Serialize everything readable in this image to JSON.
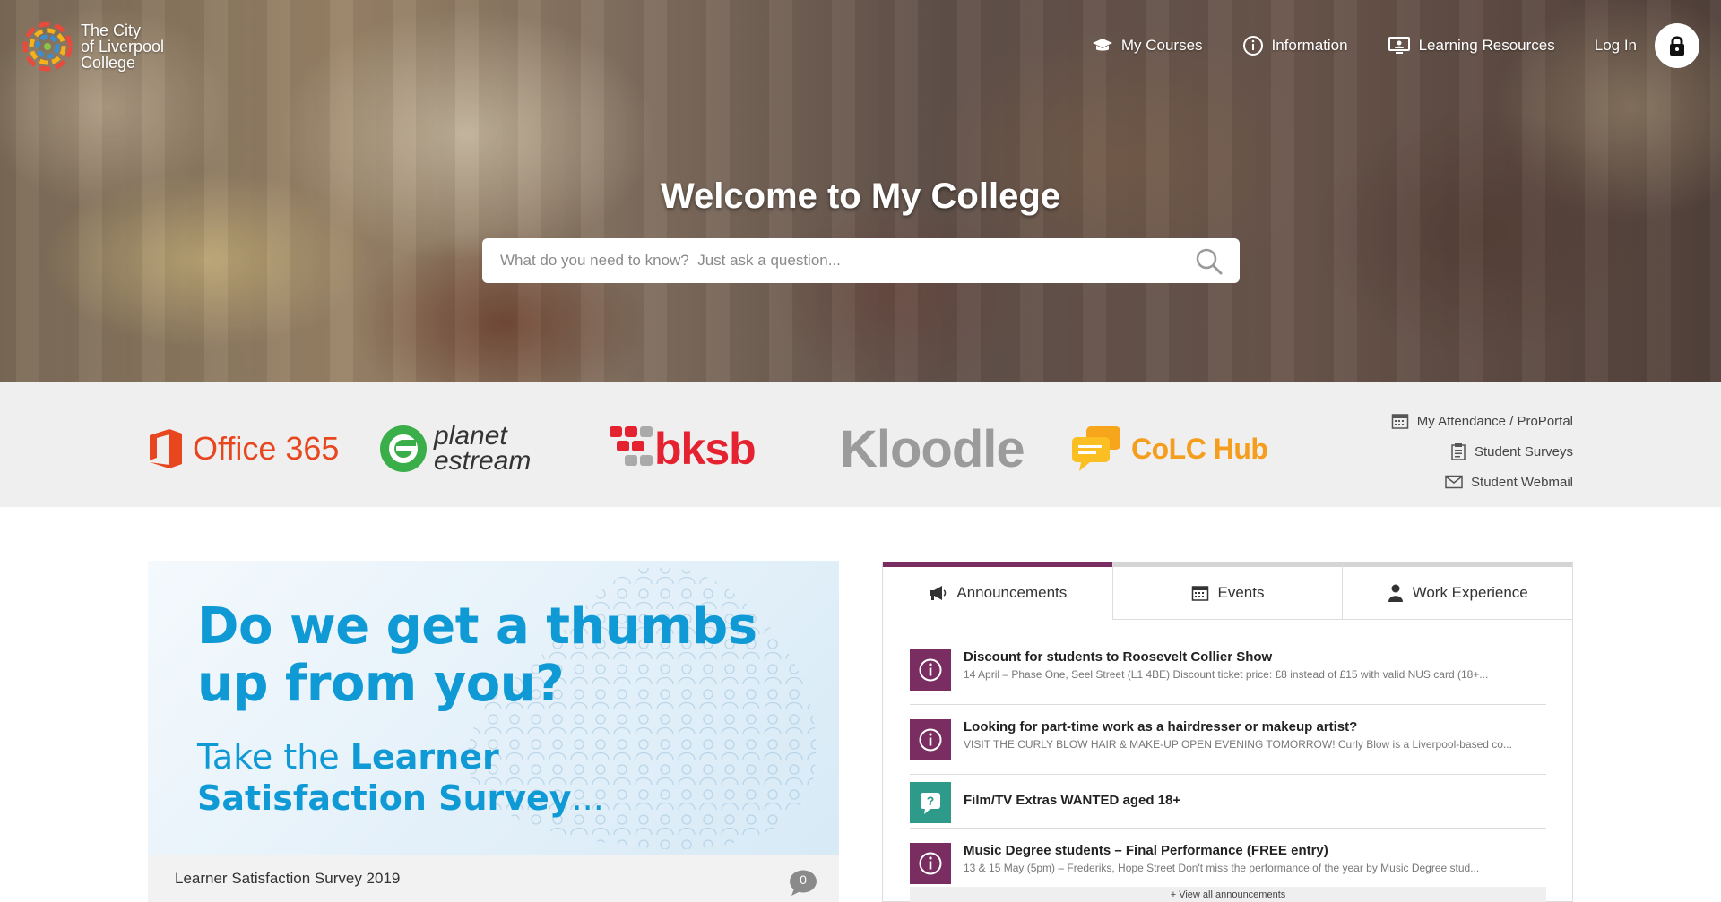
{
  "brand": {
    "line1": "The City",
    "line2": "of Liverpool",
    "line3": "College"
  },
  "nav": {
    "my_courses": "My Courses",
    "information": "Information",
    "learning_resources": "Learning Resources",
    "login": "Log In"
  },
  "hero": {
    "title": "Welcome to My College",
    "search_placeholder": "What do you need to know?  Just ask a question..."
  },
  "apps": {
    "office365": "Office 365",
    "planet_line1": "planet",
    "planet_line2": "estream",
    "bksb": "bksb",
    "kloodle": "Kloodle",
    "colc_hub": "CoLC Hub"
  },
  "quick_links": [
    {
      "label": "My Attendance / ProPortal",
      "icon": "calendar-icon"
    },
    {
      "label": "Student Surveys",
      "icon": "clipboard-icon"
    },
    {
      "label": "Student Webmail",
      "icon": "envelope-icon"
    }
  ],
  "feature": {
    "headline_line1": "Do we get a thumbs",
    "headline_line2": "up from you?",
    "sub_prefix": "Take the ",
    "sub_bold1": "Learner",
    "sub_bold2": "Satisfaction Survey",
    "sub_suffix": "...",
    "title": "Learner Satisfaction Survey 2019",
    "comments": "0"
  },
  "tabs": [
    {
      "label": "Announcements",
      "icon": "megaphone-icon",
      "active": true
    },
    {
      "label": "Events",
      "icon": "calendar-icon",
      "active": false
    },
    {
      "label": "Work Experience",
      "icon": "person-icon",
      "active": false
    }
  ],
  "announcements": [
    {
      "title": "Discount for students to Roosevelt Collier Show",
      "desc": "14 April – Phase One, Seel Street (L1 4BE) Discount ticket price: £8 instead of £15 with valid NUS card (18+...",
      "icon": "info-icon",
      "color": "#7a2d61"
    },
    {
      "title": "Looking for part-time work as a hairdresser or makeup artist?",
      "desc": "VISIT THE CURLY BLOW HAIR & MAKE-UP OPEN EVENING TOMORROW! Curly Blow is a Liverpool-based co...",
      "icon": "info-icon",
      "color": "#7a2d61"
    },
    {
      "title": "Film/TV Extras WANTED aged 18+",
      "desc": "",
      "icon": "question-icon",
      "color": "#2e9b8a"
    },
    {
      "title": "Music Degree students – Final Performance (FREE entry)",
      "desc": "13 & 15 May (5pm) – Frederiks, Hope Street Don't miss the performance of the year by Music Degree stud...",
      "icon": "info-icon",
      "color": "#7a2d61"
    }
  ],
  "view_all": "+ View all announcements",
  "colors": {
    "accent_purple": "#7a2d61",
    "accent_teal": "#2e9b8a",
    "banner_blue": "#0f9ad6"
  }
}
